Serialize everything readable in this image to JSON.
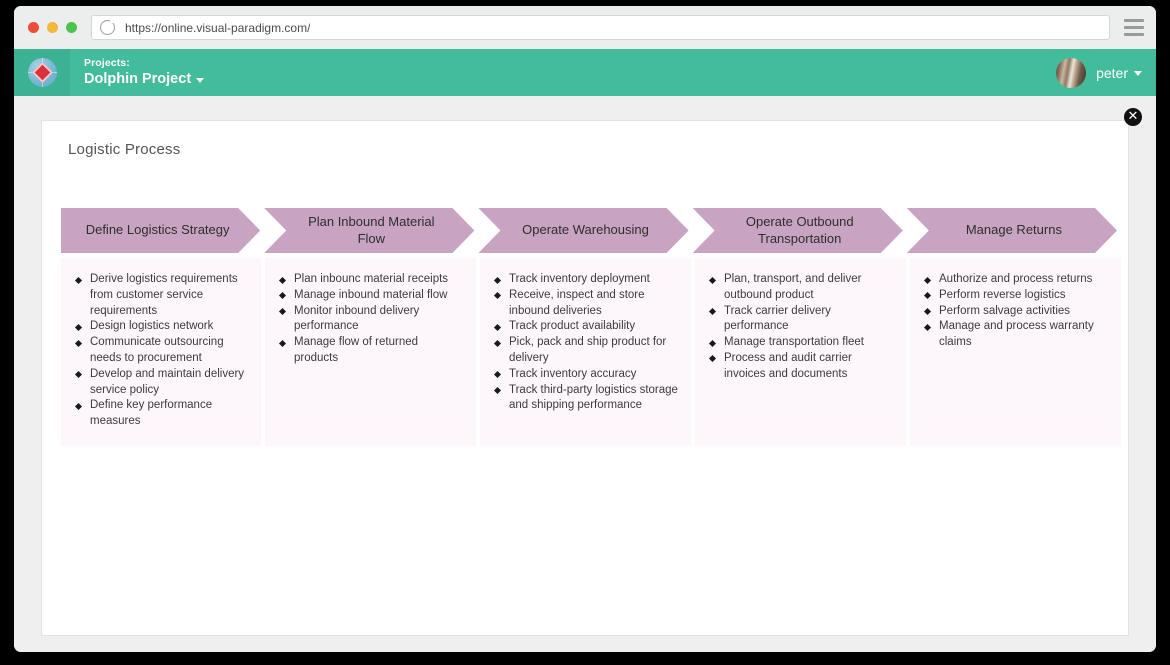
{
  "browser": {
    "url": "https://online.visual-paradigm.com/",
    "reload_icon": "reload-circle-icon",
    "menu_icon": "hamburger-menu-icon",
    "traffic_lights": [
      "close-red",
      "minimize-yellow",
      "maximize-green"
    ]
  },
  "app_bar": {
    "logo_icon": "visual-paradigm-logo-icon",
    "project_label": "Projects:",
    "project_name": "Dolphin Project",
    "project_caret_icon": "caret-down-icon",
    "user_name": "peter",
    "user_caret_icon": "caret-down-icon",
    "avatar_icon": "user-avatar",
    "background_color": "#43bc9c"
  },
  "content": {
    "title": "Logistic Process",
    "close_label": "✕",
    "close_icon": "close-circle-icon",
    "chevron_color": "#c8a4c2",
    "card_color": "#fdf7fb"
  },
  "chart_data": {
    "type": "table",
    "title": "Logistic Process",
    "layout": "horizontal-chevron-process-flow",
    "columns": [
      {
        "header": "Define Logistics Strategy",
        "items": [
          "Derive logistics requirements from customer service requirements",
          "Design logistics network",
          "Communicate outsourcing needs to procurement",
          "Develop and maintain delivery service policy",
          "Define key performance measures"
        ]
      },
      {
        "header": "Plan Inbound Material Flow",
        "items": [
          "Plan inbounc material receipts",
          "Manage inbound material flow",
          "Monitor inbound delivery performance",
          "Manage flow of returned products"
        ]
      },
      {
        "header": "Operate Warehousing",
        "items": [
          "Track inventory deployment",
          "Receive, inspect and store inbound deliveries",
          "Track product availability",
          "Pick, pack and ship product for delivery",
          "Track inventory accuracy",
          "Track third-party logistics storage and shipping performance"
        ]
      },
      {
        "header": "Operate Outbound Transportation",
        "items": [
          "Plan, transport, and deliver outbound product",
          "Track carrier delivery performance",
          "Manage transportation fleet",
          "Process and audit carrier invoices and documents"
        ]
      },
      {
        "header": "Manage Returns",
        "items": [
          "Authorize and process returns",
          "Perform reverse logistics",
          "Perform salvage activities",
          "Manage and process warranty claims"
        ]
      }
    ]
  }
}
